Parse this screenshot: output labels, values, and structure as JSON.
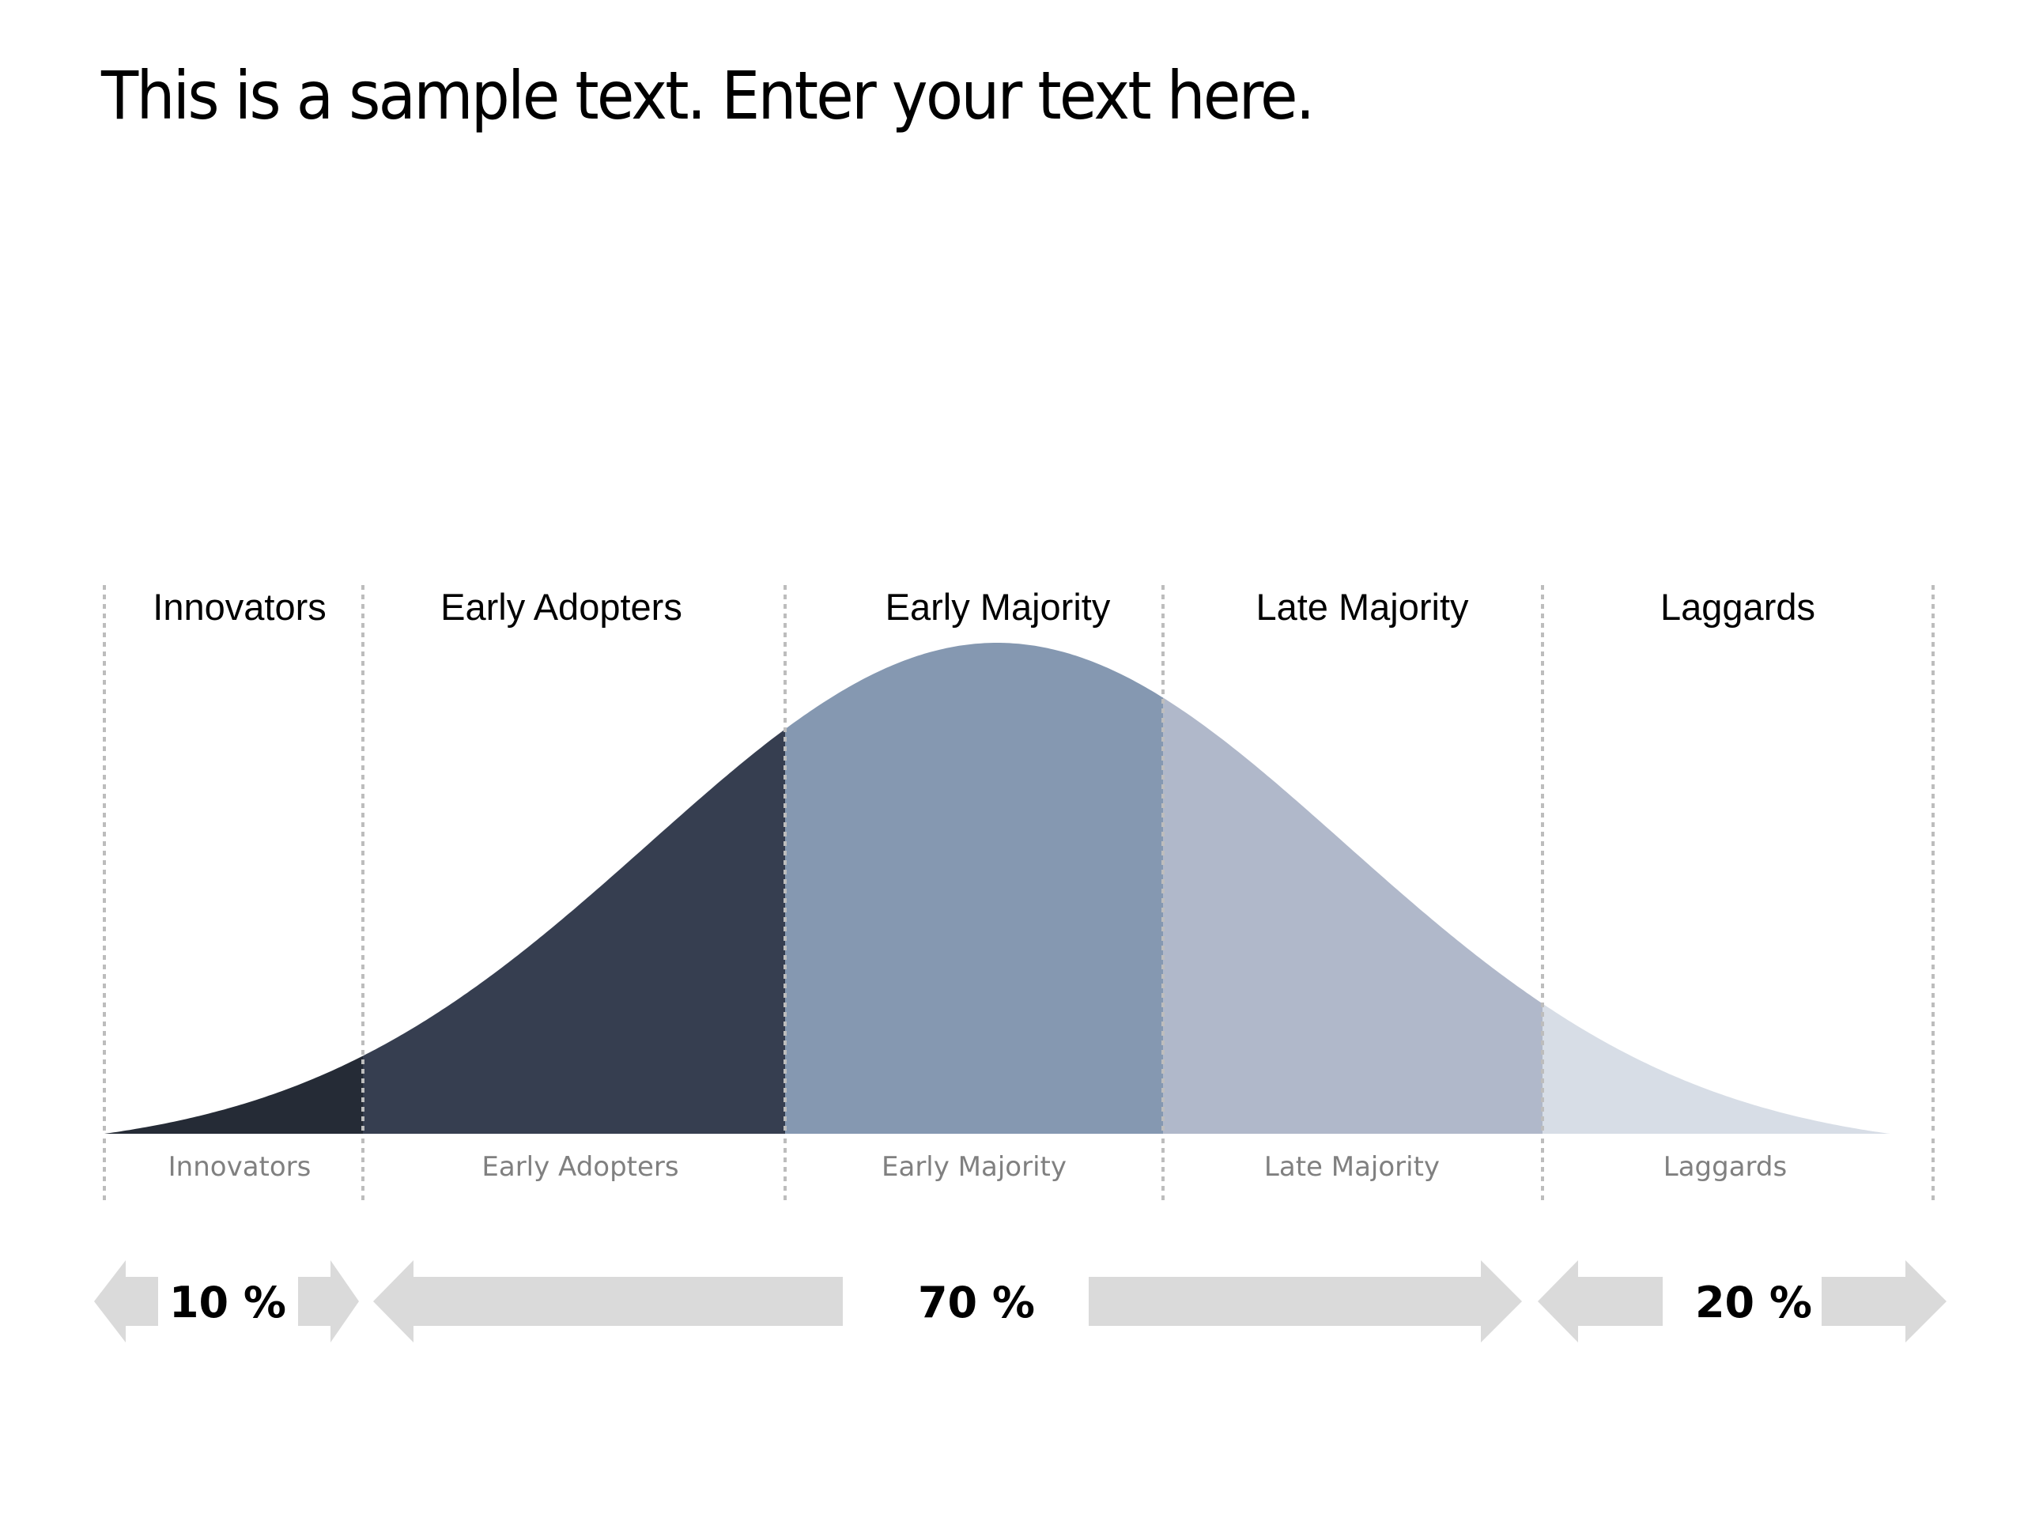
{
  "title": "This is a sample text. Enter your text here.",
  "chart_data": {
    "type": "area",
    "title": "This is a sample text. Enter your text here.",
    "description": "Diffusion of innovations bell curve split into five adopter segments",
    "x_range": [
      -3,
      3
    ],
    "segments": [
      {
        "name": "Innovators",
        "top_label": "Innovators",
        "bottom_label": "Innovators",
        "x_start": -3.0,
        "x_end": -2.0,
        "color": "#252b36"
      },
      {
        "name": "Early Adopters",
        "top_label": "Early Adopters",
        "bottom_label": "Early Adopters",
        "x_start": -2.0,
        "x_end": -0.6,
        "color": "#363e50"
      },
      {
        "name": "Early Majority",
        "top_label": "Early Majority",
        "bottom_label": "Early Majority",
        "x_start": -0.6,
        "x_end": 0.6,
        "color": "#8598b1"
      },
      {
        "name": "Late Majority",
        "top_label": "Late Majority",
        "bottom_label": "Late Majority",
        "x_start": 0.6,
        "x_end": 1.8,
        "color": "#b0b8ca"
      },
      {
        "name": "Laggards",
        "top_label": "Laggards",
        "bottom_label": "Laggards",
        "x_start": 1.8,
        "x_end": 3.0,
        "color": "#d7dde6"
      }
    ],
    "percent_groups": [
      {
        "label": "10 %",
        "value": 10,
        "spans": [
          "Innovators"
        ]
      },
      {
        "label": "70 %",
        "value": 70,
        "spans": [
          "Early Adopters",
          "Early Majority",
          "Late Majority"
        ]
      },
      {
        "label": "20 %",
        "value": 20,
        "spans": [
          "Laggards"
        ]
      }
    ],
    "colors": {
      "arrow": "#dadada",
      "divider": "#bdbdbd",
      "bottom_label": "#808080"
    }
  }
}
